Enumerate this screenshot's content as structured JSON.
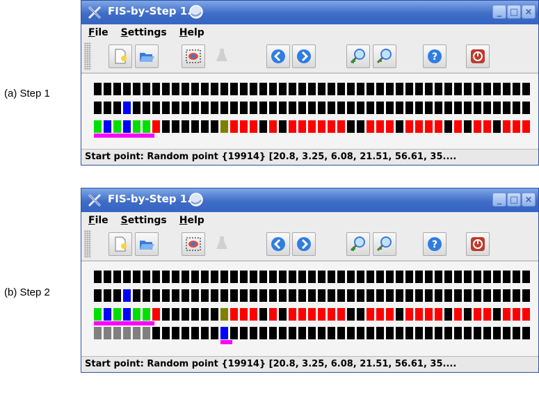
{
  "captions": [
    "(a) Step 1",
    "(b) Step 2"
  ],
  "window": {
    "title": "FIS-by-Step 1.2",
    "menus": [
      {
        "mnemonic": "F",
        "rest": "ile"
      },
      {
        "mnemonic": "S",
        "rest": "ettings"
      },
      {
        "mnemonic": "H",
        "rest": "elp"
      }
    ],
    "toolbar_icons": [
      "new-file-icon",
      "open-folder-icon",
      "select-region-icon",
      "flask-icon",
      "back-arrow-icon",
      "forward-arrow-icon",
      "zoom-in-icon",
      "zoom-out-icon",
      "help-icon",
      "power-icon"
    ],
    "status": "Start point: Random point {19914} [20.8, 3.25, 6.08, 21.51, 56.61, 35...."
  },
  "colors": {
    "g": "#00e000",
    "b": "#0000ff",
    "r": "#ff0000",
    "o": "#808000",
    "k": "#000000",
    "y": "#808080",
    "bar": "#ff00ff"
  },
  "panels": [
    {
      "rows": [
        "kkkkkkkkkkkkkkkkkkkkkkkkkkkkkkkkkkkkkkkkkkkkk",
        "kkkbkkkkkkkkkkkkkkkkkkkkkkkkkkkkkkkkkkkkkkkkk",
        "gbgbggrkkkkkkorrrkrkrrrrrrkkrrrkrrrrkrkrrkrrr"
      ],
      "bars": [
        {
          "row": 2,
          "start": 0,
          "end": 6
        }
      ]
    },
    {
      "rows": [
        "kkkkkkkkkkkkkkkkkkkkkkkkkkkkkkkkkkkkkkkkkkkkk",
        "kkkbkkkkkkkkkkkkkkkkkkkkkkkkkkkkkkkkkkkkkkkkk",
        "gbgbggrkkkkkkorrrkrkrrrrrrkkrrrkrrrrkrkrrkrrr",
        "yyyyyykkkkkkkbkkkkkkkkkkkkkkkkkkkkkkkkkkkkkkk"
      ],
      "bars": [
        {
          "row": 2,
          "start": 0,
          "end": 6
        },
        {
          "row": 3,
          "start": 13,
          "end": 14
        }
      ]
    }
  ]
}
